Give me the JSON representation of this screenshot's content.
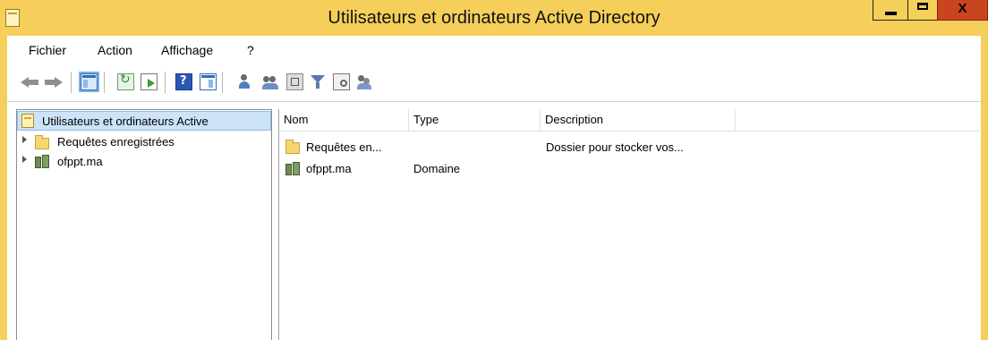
{
  "window": {
    "title": "Utilisateurs et ordinateurs Active Directory",
    "controls": {
      "minimize": "minimize-icon",
      "maximize": "maximize-icon",
      "close": "close-icon"
    },
    "colors": {
      "titlebar": "#f6cf5a",
      "close": "#c9451f",
      "selection": "#cde3f7"
    }
  },
  "menu": {
    "items": [
      "Fichier",
      "Action",
      "Affichage",
      "?"
    ]
  },
  "toolbar": {
    "icons": [
      "back-arrow-icon",
      "forward-arrow-icon",
      "show-hide-console-tree-icon",
      "refresh-icon",
      "export-list-icon",
      "help-icon",
      "show-hide-action-pane-icon",
      "new-user-icon",
      "new-group-icon",
      "new-ou-icon",
      "filter-icon",
      "find-icon",
      "add-to-group-icon"
    ]
  },
  "tree": {
    "root": "Utilisateurs et ordinateurs Active",
    "items": [
      {
        "label": "Requêtes enregistrées",
        "icon": "folder-icon"
      },
      {
        "label": "ofppt.ma",
        "icon": "domain-icon"
      }
    ]
  },
  "list": {
    "columns": [
      "Nom",
      "Type",
      "Description"
    ],
    "rows": [
      {
        "name": "Requêtes en...",
        "type": "",
        "description": "Dossier pour stocker vos...",
        "icon": "folder-icon"
      },
      {
        "name": "ofppt.ma",
        "type": "Domaine",
        "description": "",
        "icon": "domain-icon"
      }
    ]
  }
}
